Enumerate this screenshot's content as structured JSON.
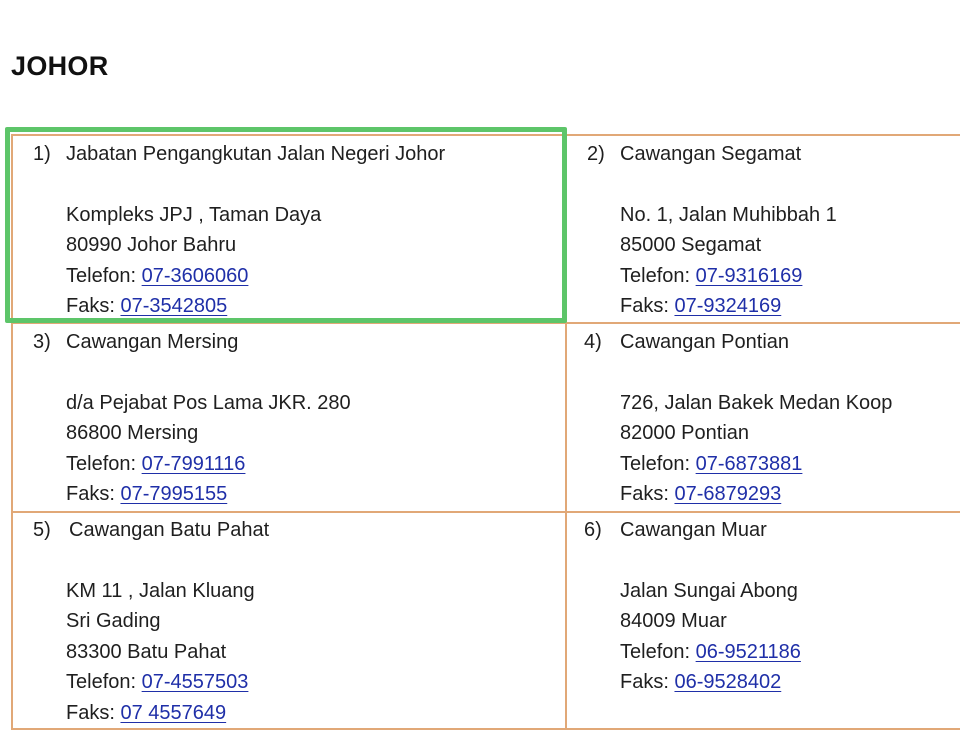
{
  "page": {
    "title": "JOHOR"
  },
  "offices": [
    {
      "number": "1)",
      "name": "Jabatan Pengangkutan Jalan Negeri Johor",
      "address": [
        "Kompleks JPJ , Taman Daya",
        "80990 Johor Bahru"
      ],
      "phone_label": "Telefon:",
      "phone": "07-3606060",
      "fax_label": "Faks:",
      "fax": "07-3542805"
    },
    {
      "number": "2)",
      "name": "Cawangan Segamat",
      "address": [
        "No. 1, Jalan Muhibbah 1",
        "85000 Segamat"
      ],
      "phone_label": "Telefon:",
      "phone": "07-9316169",
      "fax_label": "Faks:",
      "fax": "07-9324169"
    },
    {
      "number": "3)",
      "name": "Cawangan Mersing",
      "address": [
        "d/a Pejabat Pos Lama JKR. 280",
        "86800 Mersing"
      ],
      "phone_label": "Telefon:",
      "phone": "07-7991116",
      "fax_label": "Faks:",
      "fax": "07-7995155"
    },
    {
      "number": "4)",
      "name": "Cawangan Pontian",
      "address": [
        "726, Jalan Bakek Medan Koop",
        "82000 Pontian"
      ],
      "phone_label": "Telefon:",
      "phone": "07-6873881",
      "fax_label": "Faks:",
      "fax": "07-6879293"
    },
    {
      "number": "5)",
      "name": "Cawangan Batu Pahat",
      "address": [
        "KM 11 , Jalan Kluang",
        "Sri Gading",
        "83300 Batu Pahat"
      ],
      "phone_label": "Telefon:",
      "phone": "07-4557503",
      "fax_label": "Faks:",
      "fax": "07 4557649"
    },
    {
      "number": "6)",
      "name": "Cawangan Muar",
      "address": [
        "Jalan Sungai Abong",
        "84009 Muar"
      ],
      "phone_label": "Telefon:",
      "phone": "06-9521186",
      "fax_label": "Faks:",
      "fax": "06-9528402"
    }
  ],
  "colors": {
    "table_border": "#e1a877",
    "link": "#1f2fa8",
    "highlight": "#5dc569"
  }
}
